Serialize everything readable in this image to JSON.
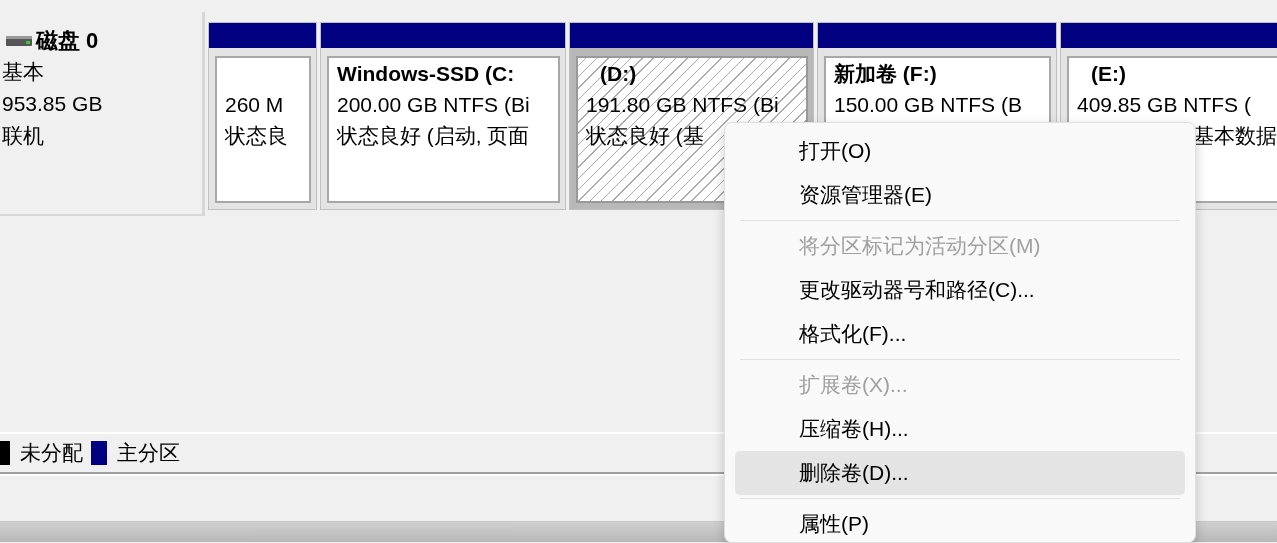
{
  "disk": {
    "name": "磁盘 0",
    "type": "基本",
    "size": "953.85 GB",
    "status": "联机"
  },
  "partitions": [
    {
      "size": "260 M",
      "status": "状态良",
      "selected": false,
      "color": "#000080"
    },
    {
      "title": "Windows-SSD  (C:",
      "size": "200.00 GB NTFS (Bi",
      "status": "状态良好 (启动, 页面",
      "selected": false,
      "color": "#000080"
    },
    {
      "title": "(D:)",
      "size": "191.80 GB NTFS (Bi",
      "status": "状态良好 (基",
      "selected": true,
      "color": "#000080"
    },
    {
      "title": "新加卷 (F:)",
      "size": "150.00 GB NTFS (B",
      "selected": false,
      "color": "#000080"
    },
    {
      "title": "(E:)",
      "size": "409.85 GB NTFS (",
      "status": "基本数据",
      "selected": false,
      "color": "#000080"
    }
  ],
  "legend": [
    {
      "label": "未分配",
      "color": "#000000"
    },
    {
      "label": "主分区",
      "color": "#000080"
    }
  ],
  "context_menu": [
    {
      "kind": "item",
      "label": "打开(O)",
      "disabled": false,
      "selected": false
    },
    {
      "kind": "item",
      "label": "资源管理器(E)",
      "disabled": false,
      "selected": false
    },
    {
      "kind": "separator"
    },
    {
      "kind": "item",
      "label": "将分区标记为活动分区(M)",
      "disabled": true,
      "selected": false
    },
    {
      "kind": "item",
      "label": "更改驱动器号和路径(C)...",
      "disabled": false,
      "selected": false
    },
    {
      "kind": "item",
      "label": "格式化(F)...",
      "disabled": false,
      "selected": false
    },
    {
      "kind": "separator"
    },
    {
      "kind": "item",
      "label": "扩展卷(X)...",
      "disabled": true,
      "selected": false
    },
    {
      "kind": "item",
      "label": "压缩卷(H)...",
      "disabled": false,
      "selected": false
    },
    {
      "kind": "item",
      "label": "删除卷(D)...",
      "disabled": false,
      "selected": true
    },
    {
      "kind": "separator"
    },
    {
      "kind": "item",
      "label": "属性(P)",
      "disabled": false,
      "selected": false
    }
  ]
}
